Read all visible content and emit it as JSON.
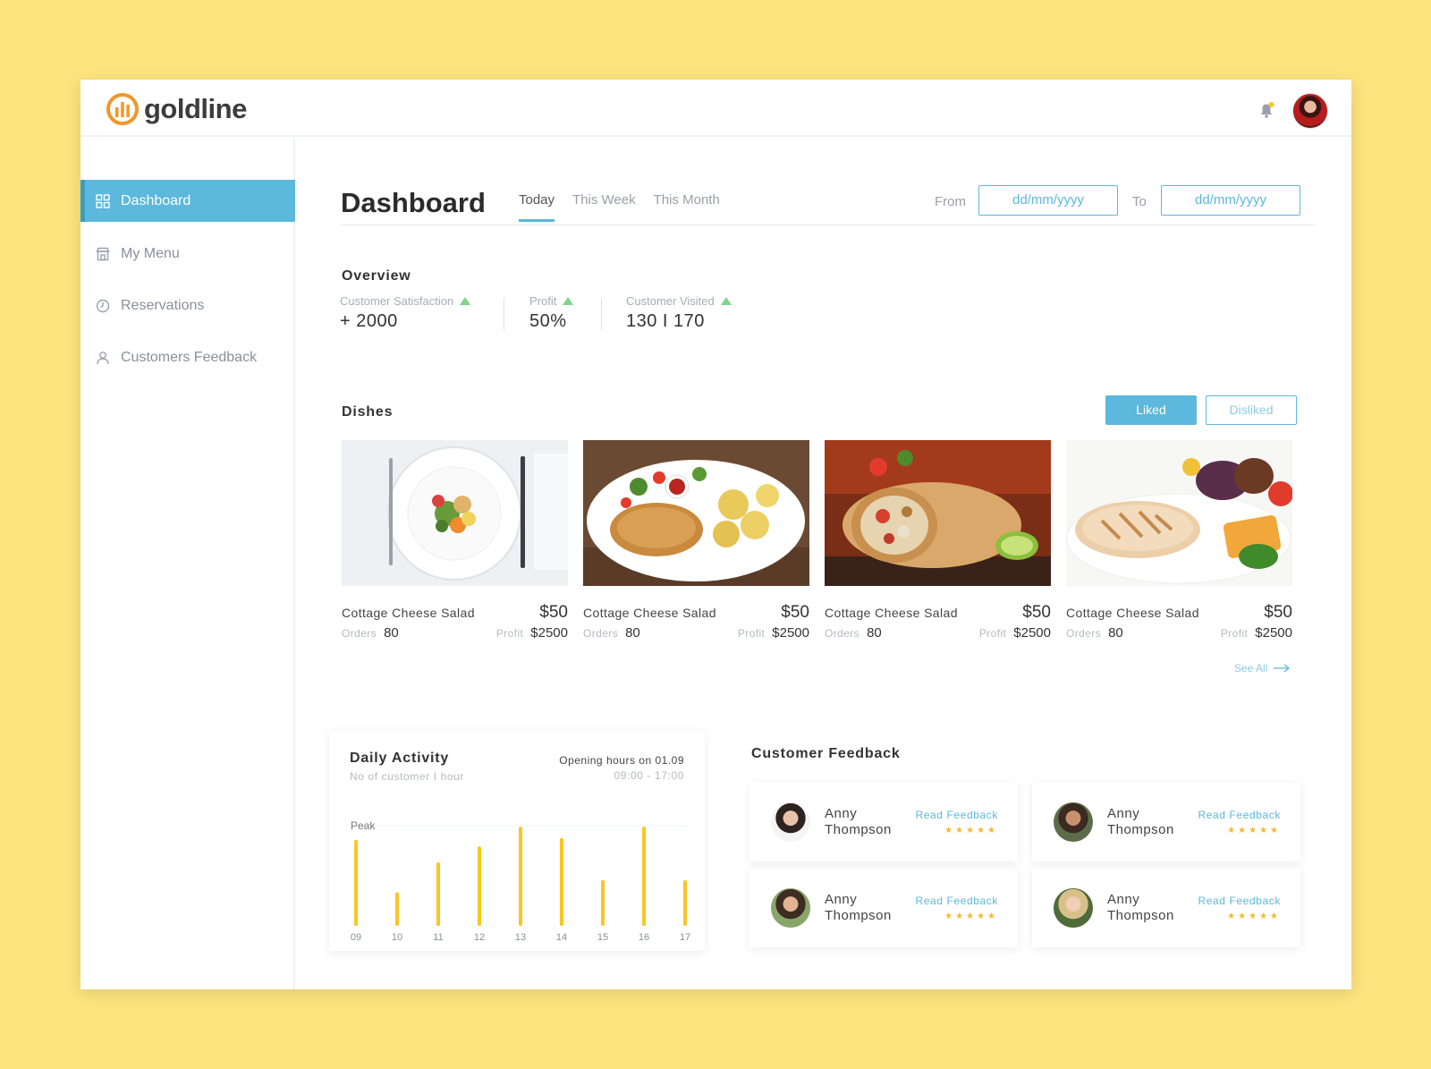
{
  "brand": {
    "name": "goldline",
    "accent": "#5cb8dc",
    "logo_color": "#f0972a"
  },
  "sidebar": {
    "items": [
      {
        "label": "Dashboard",
        "icon": "grid-icon",
        "active": true
      },
      {
        "label": "My Menu",
        "icon": "store-icon",
        "active": false
      },
      {
        "label": "Reservations",
        "icon": "clock-icon",
        "active": false
      },
      {
        "label": "Customers Feedback",
        "icon": "user-icon",
        "active": false
      }
    ]
  },
  "header": {
    "title": "Dashboard",
    "tabs": [
      "Today",
      "This Week",
      "This Month"
    ],
    "active_tab": "Today",
    "from_label": "From",
    "to_label": "To",
    "from_placeholder": "dd/mm/yyyy",
    "to_placeholder": "dd/mm/yyyy"
  },
  "overview": {
    "title": "Overview",
    "metrics": [
      {
        "label": "Customer Satisfaction",
        "value": "+ 2000",
        "trend": "up"
      },
      {
        "label": "Profit",
        "value": "50%",
        "trend": "up"
      },
      {
        "label": "Customer Visited",
        "value": "130 I 170",
        "trend": "up"
      }
    ]
  },
  "dishes": {
    "title": "Dishes",
    "liked_label": "Liked",
    "disliked_label": "Disliked",
    "orders_label": "Orders",
    "profit_label": "Profit",
    "see_all": "See All",
    "items": [
      {
        "name": "Cottage Cheese Salad",
        "price": "$50",
        "orders": "80",
        "profit": "$2500",
        "image": "salad-plate"
      },
      {
        "name": "Cottage Cheese Salad",
        "price": "$50",
        "orders": "80",
        "profit": "$2500",
        "image": "schnitzel-potatoes"
      },
      {
        "name": "Cottage Cheese Salad",
        "price": "$50",
        "orders": "80",
        "profit": "$2500",
        "image": "burrito-wrap"
      },
      {
        "name": "Cottage Cheese Salad",
        "price": "$50",
        "orders": "80",
        "profit": "$2500",
        "image": "grilled-chicken"
      }
    ]
  },
  "daily_activity": {
    "title": "Daily Activity",
    "subtitle": "No of customer I hour",
    "opening_label": "Opening hours on 01.09",
    "opening_hours": "09:00 - 17:00",
    "peak_label": "Peak",
    "bar_color": "#f9c623"
  },
  "chart_data": {
    "type": "bar",
    "categories": [
      "09",
      "10",
      "11",
      "12",
      "13",
      "14",
      "15",
      "16",
      "17"
    ],
    "values": [
      88,
      32,
      64,
      81,
      102,
      90,
      45,
      102,
      45
    ],
    "ylim": [
      0,
      105
    ],
    "grid": false
  },
  "feedback": {
    "title": "Customer Feedback",
    "link_label": "Read Feedback",
    "items": [
      {
        "name": "Anny Thompson",
        "stars": "★★★★★"
      },
      {
        "name": "Anny Thompson",
        "stars": "★★★★★"
      },
      {
        "name": "Anny Thompson",
        "stars": "★★★★★"
      },
      {
        "name": "Anny Thompson",
        "stars": "★★★★★"
      }
    ]
  }
}
